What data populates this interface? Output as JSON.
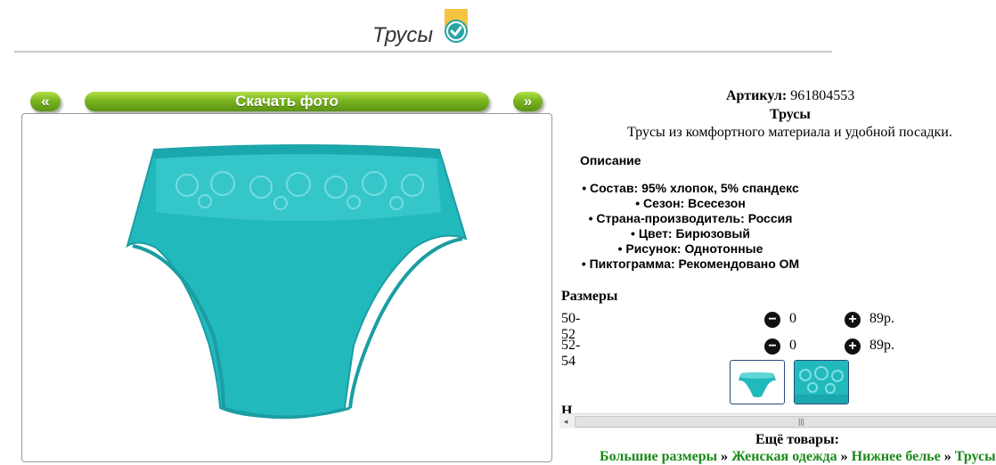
{
  "header": {
    "title": "Трусы"
  },
  "gallery": {
    "prev_label": "«",
    "download_label": "Скачать фото",
    "next_label": "»"
  },
  "product": {
    "article_label": "Артикул:",
    "article_value": "961804553",
    "name": "Трусы",
    "short_description": "Трусы из комфортного материала и удобной посадки.",
    "description_heading": "Описание",
    "specs": [
      "Состав: 95% хлопок, 5% спандекс",
      "Сезон: Всесезон",
      "Страна-производитель: Россия",
      "Цвет: Бирюзовый",
      "Рисунок: Однотонные",
      "Пиктограмма: Рекомендовано ОМ"
    ],
    "color": "#22b9bd"
  },
  "sizes": {
    "heading": "Размеры",
    "rows": [
      {
        "size": "50-52",
        "qty": "0",
        "price": "89р."
      },
      {
        "size": "52-54",
        "qty": "0",
        "price": "89р."
      }
    ]
  },
  "more": {
    "heading": "Ещё товары:",
    "breadcrumbs": [
      "Большие размеры",
      "Женская одежда",
      "Нижнее белье",
      "Трусы"
    ],
    "separator": "»"
  },
  "scrollbar": {
    "left_arrow": "◂",
    "grip": "|||"
  },
  "partial_text": "Н",
  "icons": {
    "badge": "check-badge-icon",
    "minus": "minus-circle-icon",
    "plus": "plus-circle-icon"
  },
  "theme": {
    "button_green": "#7ab520",
    "link_green": "#1a8a1a",
    "badge_yellow": "#f5c542",
    "badge_teal": "#2aa3a3"
  }
}
